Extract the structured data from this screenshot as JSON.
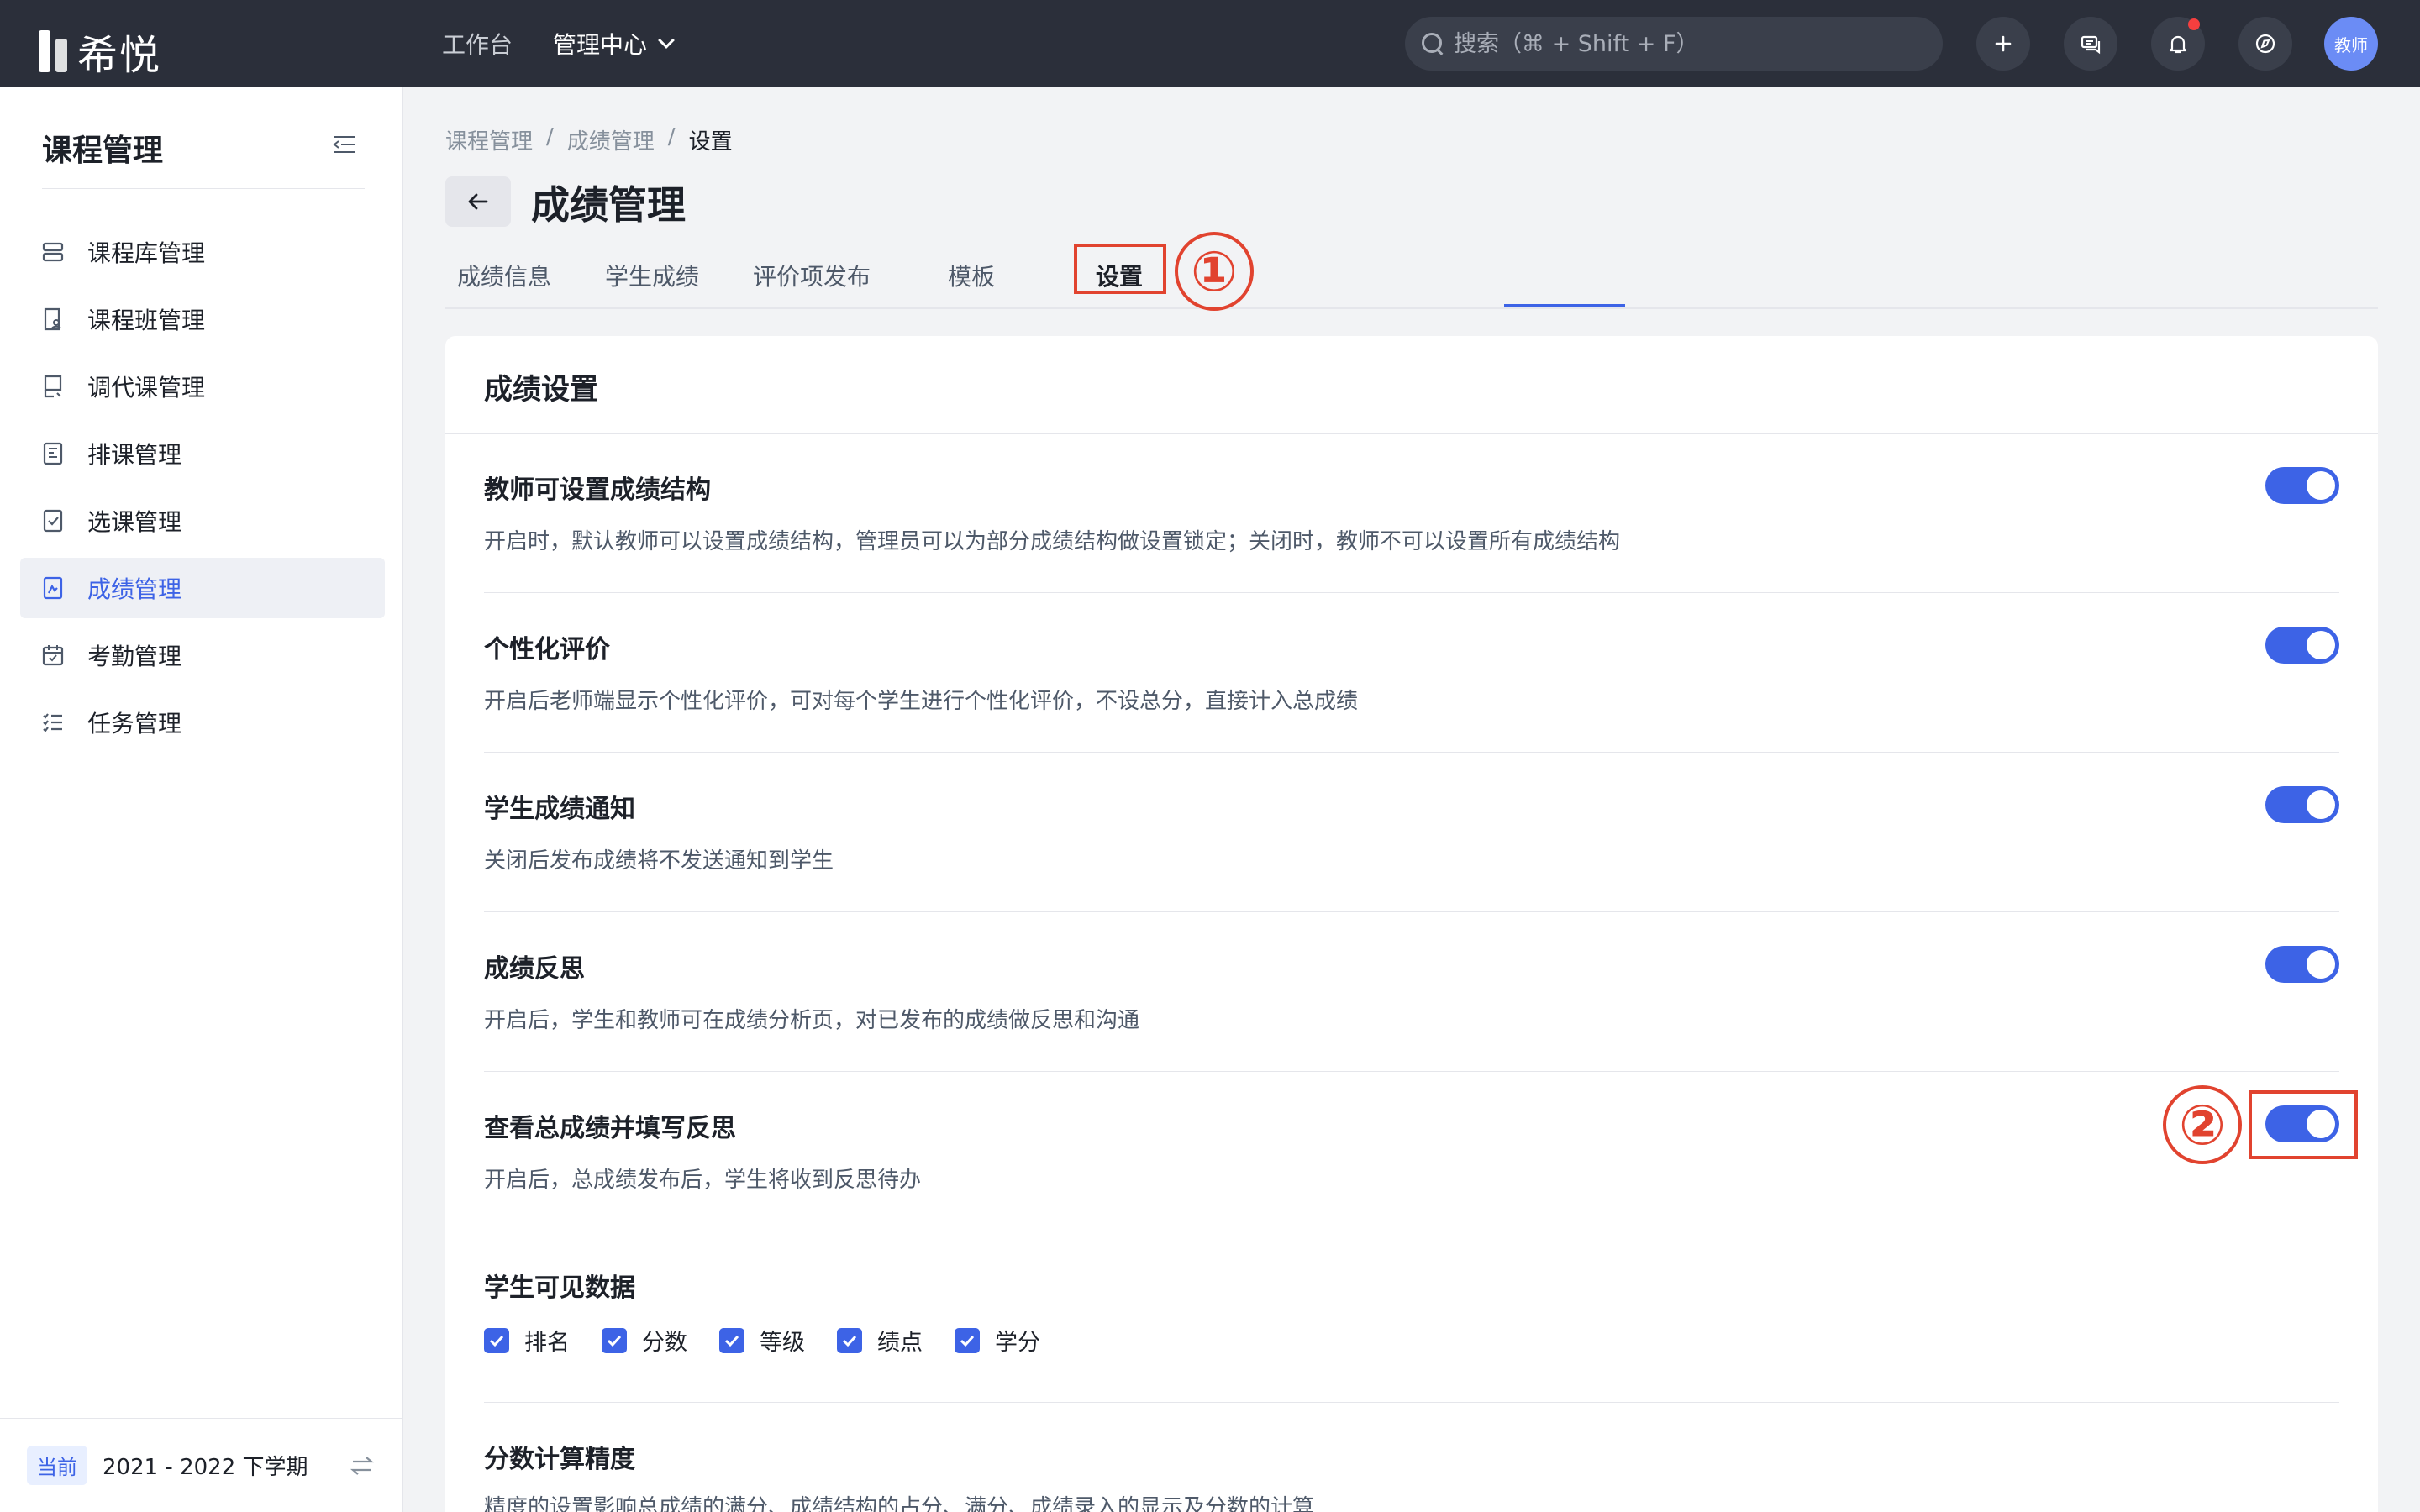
{
  "app": {
    "logo_text": "希悦"
  },
  "topnav": {
    "items": [
      "工作台",
      "管理中心"
    ],
    "search_placeholder": "搜索（⌘ + Shift + F）",
    "avatar_text": "教师"
  },
  "sidebar": {
    "title": "课程管理",
    "items": [
      {
        "label": "课程库管理",
        "icon": "database-icon"
      },
      {
        "label": "课程班管理",
        "icon": "class-book-icon"
      },
      {
        "label": "调代课管理",
        "icon": "substitute-icon"
      },
      {
        "label": "排课管理",
        "icon": "schedule-icon"
      },
      {
        "label": "选课管理",
        "icon": "checklist-icon"
      },
      {
        "label": "成绩管理",
        "icon": "grade-icon",
        "active": true
      },
      {
        "label": "考勤管理",
        "icon": "calendar-icon"
      },
      {
        "label": "任务管理",
        "icon": "task-list-icon"
      }
    ],
    "footer": {
      "badge": "当前",
      "term": "2021 - 2022 下学期"
    }
  },
  "breadcrumb": [
    "课程管理",
    "/",
    "成绩管理",
    "/",
    "设置"
  ],
  "page_title": "成绩管理",
  "tabs": [
    "成绩信息",
    "学生成绩",
    "评价项发布",
    "模板",
    "设置"
  ],
  "active_tab": "设置",
  "annotations": [
    "①",
    "②"
  ],
  "card": {
    "title": "成绩设置",
    "settings": [
      {
        "title": "教师可设置成绩结构",
        "desc": "开启时，默认教师可以设置成绩结构，管理员可以为部分成绩结构做设置锁定；关闭时，教师不可以设置所有成绩结构",
        "enabled": true
      },
      {
        "title": "个性化评价",
        "desc": "开启后老师端显示个性化评价，可对每个学生进行个性化评价，不设总分，直接计入总成绩",
        "enabled": true
      },
      {
        "title": "学生成绩通知",
        "desc": "关闭后发布成绩将不发送通知到学生",
        "enabled": true
      },
      {
        "title": "成绩反思",
        "desc": "开启后，学生和教师可在成绩分析页，对已发布的成绩做反思和沟通",
        "enabled": true
      },
      {
        "title": "查看总成绩并填写反思",
        "desc": "开启后，总成绩发布后，学生将收到反思待办",
        "enabled": true
      }
    ],
    "visible_data": {
      "title": "学生可见数据",
      "options": [
        "排名",
        "分数",
        "等级",
        "绩点",
        "学分"
      ]
    },
    "precision": {
      "title": "分数计算精度",
      "desc": "精度的设置影响总成绩的满分、成绩结构的占分、满分、成绩录入的显示及分数的计算"
    }
  },
  "colors": {
    "primary": "#3d63e6",
    "annotation": "#e1432f",
    "topbar": "#2b2f3a"
  }
}
